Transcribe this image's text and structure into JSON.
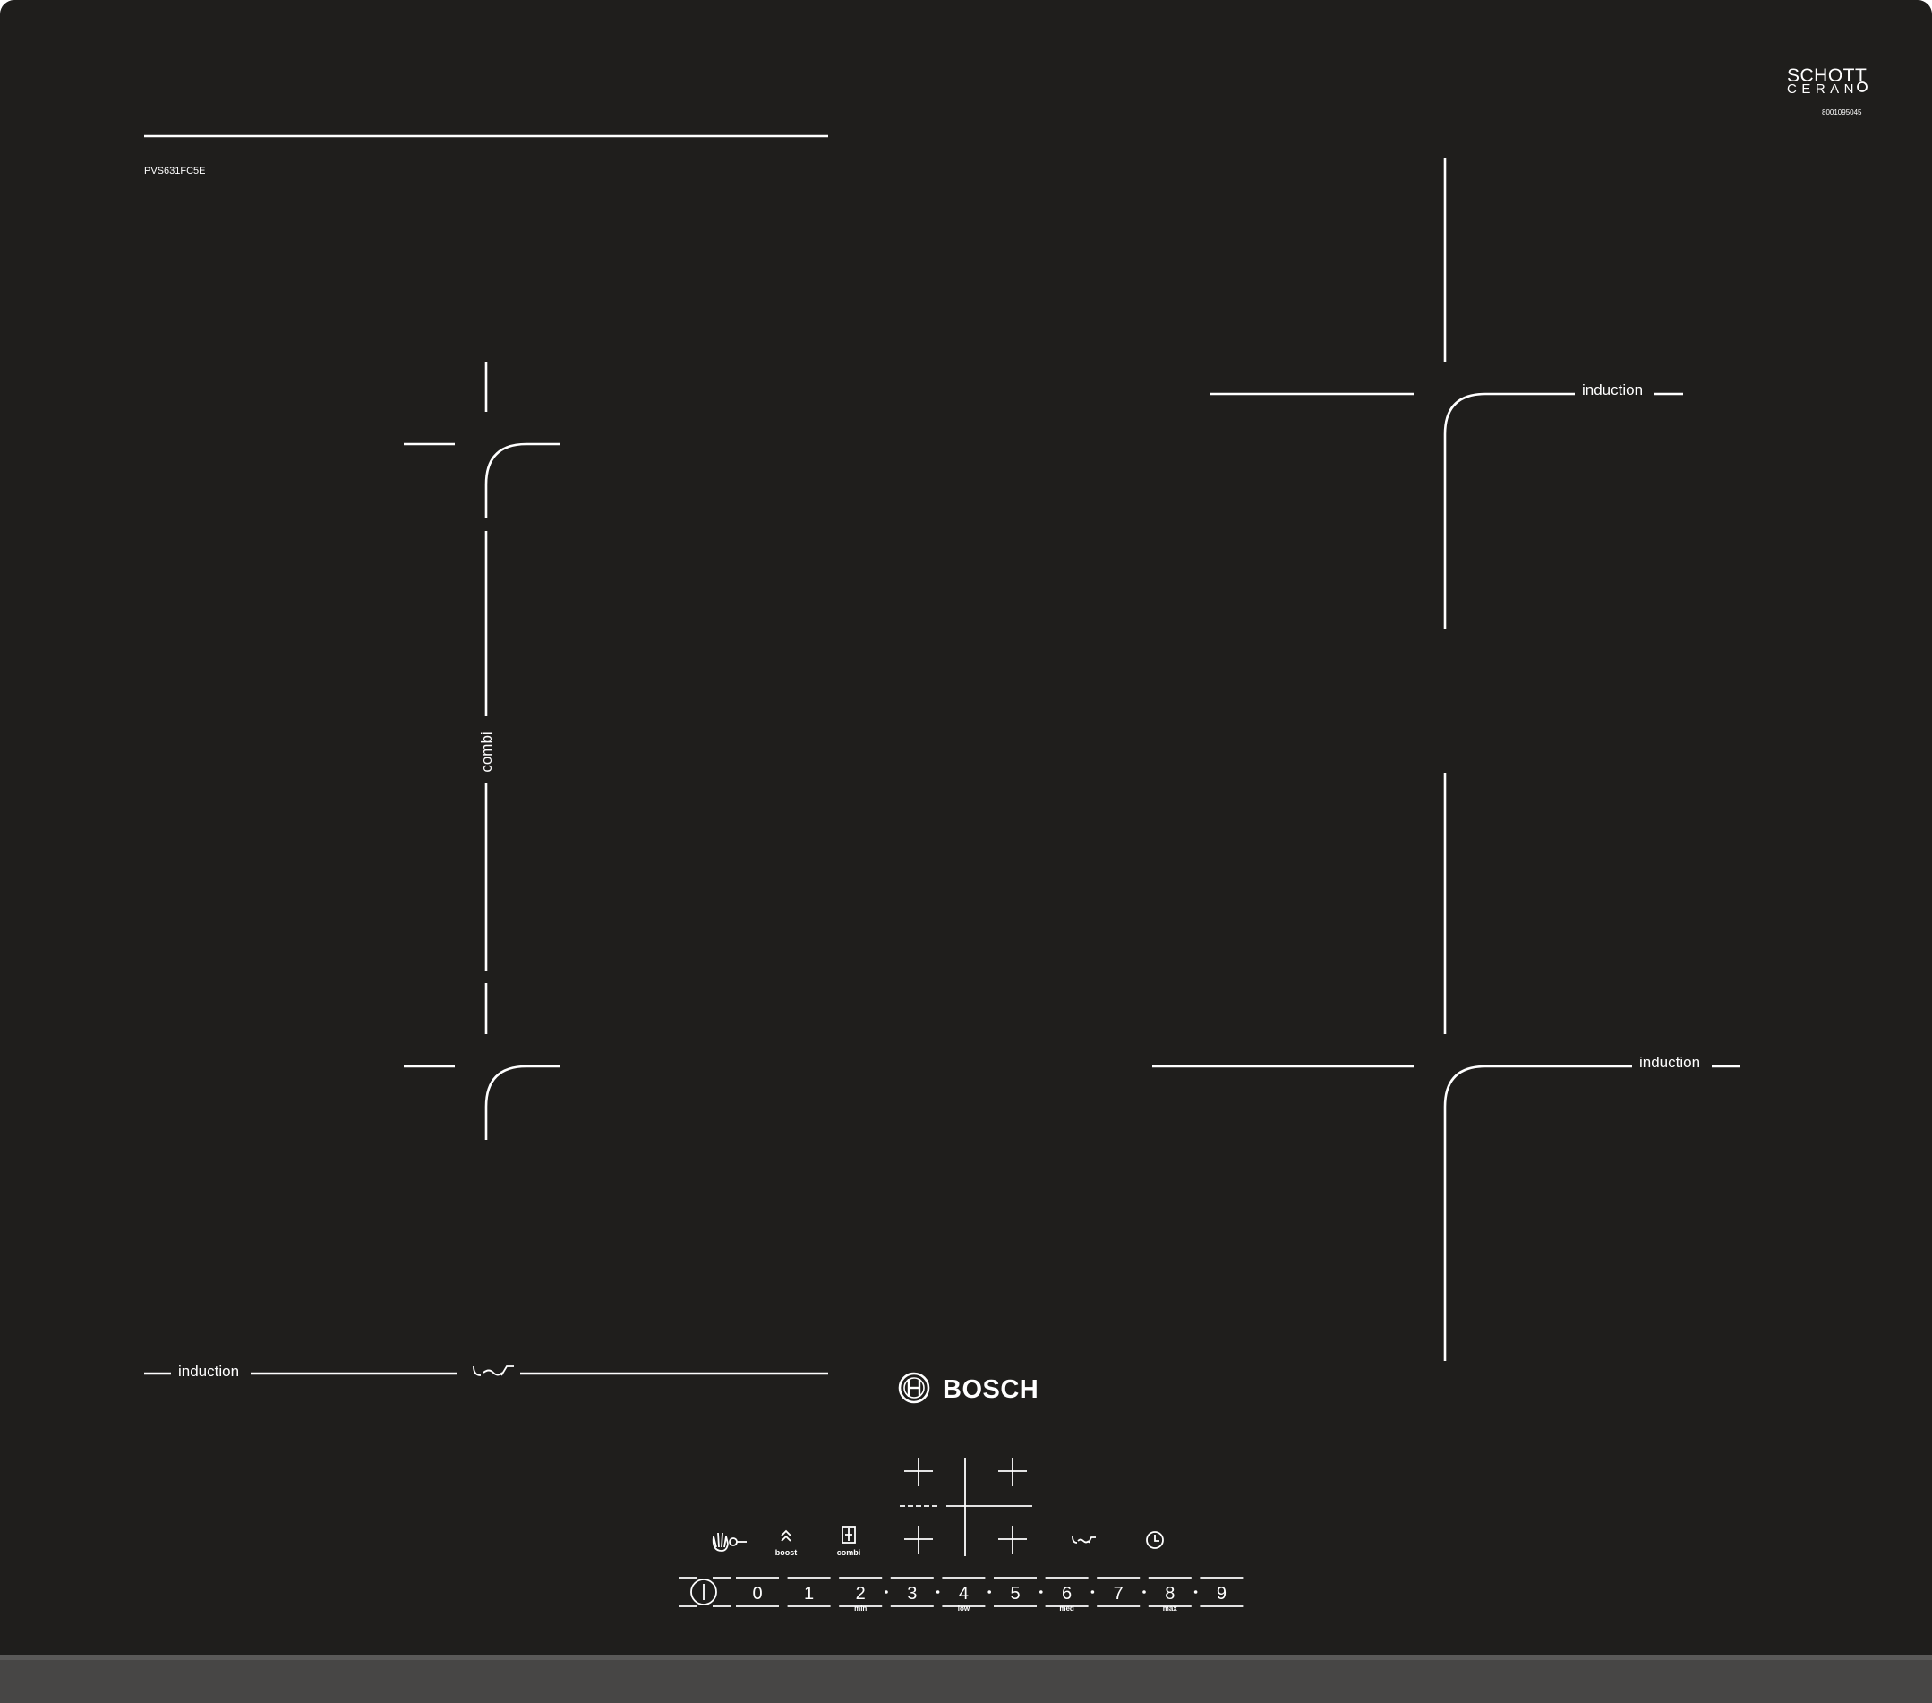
{
  "brand": {
    "name": "BOSCH",
    "logo_icon": "bosch-armature-icon"
  },
  "glass": {
    "maker_line1": "SCHOTT",
    "maker_line2": "CERAN",
    "serial": "8001095045"
  },
  "model": "PVS631FC5E",
  "zones": {
    "left_combi_label": "combi",
    "left_front_label": "induction",
    "right_rear_label": "induction",
    "right_front_label": "induction"
  },
  "controls": {
    "functions": [
      {
        "icon": "child-lock-icon",
        "label": ""
      },
      {
        "icon": "boost-icon",
        "label": "boost"
      },
      {
        "icon": "combi-zone-icon",
        "label": "combi"
      },
      {
        "icon": "cookconnect-icon",
        "label": ""
      },
      {
        "icon": "timer-icon",
        "label": ""
      }
    ],
    "power_icon": "power-icon",
    "levels": [
      "0",
      "1",
      "2",
      "3",
      "4",
      "5",
      "6",
      "7",
      "8",
      "9"
    ],
    "level_sublabels": {
      "2": "min",
      "4": "low",
      "6": "med",
      "8": "max"
    }
  },
  "colors": {
    "glass": "#1f1e1c",
    "print": "#ffffff",
    "edge": "#4a4a4a"
  }
}
